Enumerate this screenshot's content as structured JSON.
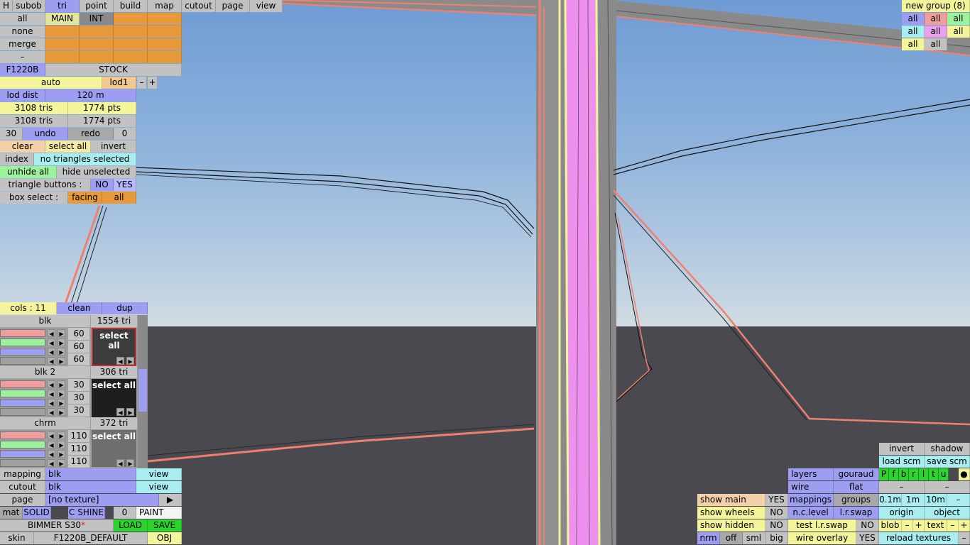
{
  "menu": {
    "h": "H",
    "tabs": [
      "subob",
      "tri",
      "point",
      "build",
      "map",
      "cutout",
      "page",
      "view"
    ],
    "active_tab": "tri"
  },
  "sel_grid": {
    "all": "all",
    "main": "MAIN",
    "int": "INT",
    "none": "none",
    "merge": "merge",
    "dash": "–"
  },
  "model": {
    "name": "F1220B",
    "config": "STOCK"
  },
  "lod": {
    "auto": "auto",
    "lod": "lod1",
    "minus": "–",
    "plus": "+",
    "dist_label": "lod dist",
    "dist_value": "120 m"
  },
  "stats": {
    "tris1": "3108 tris",
    "pts1": "1774 pts",
    "tris2": "3108 tris",
    "pts2": "1774 pts"
  },
  "undo": {
    "count": "30",
    "undo": "undo",
    "redo": "redo",
    "redo_count": "0"
  },
  "sel": {
    "clear": "clear",
    "select_all": "select all",
    "invert": "invert",
    "index": "index",
    "status": "no triangles selected",
    "unhide_all": "unhide all",
    "hide_unselected": "hide unselected"
  },
  "tri_buttons": {
    "label": "triangle buttons :",
    "no": "NO",
    "yes": "YES"
  },
  "box_select": {
    "label": "box select :",
    "facing": "facing",
    "all": "all"
  },
  "cols": {
    "label": "cols : 11",
    "clean": "clean",
    "dup": "dup"
  },
  "materials": [
    {
      "name": "blk",
      "tris": "1554 tri",
      "r": "60",
      "g": "60",
      "b": "60",
      "btn": "select all"
    },
    {
      "name": "blk 2",
      "tris": "306 tri",
      "r": "30",
      "g": "30",
      "b": "30",
      "btn": "select all"
    },
    {
      "name": "chrm",
      "tris": "372 tri",
      "r": "110",
      "g": "110",
      "b": "110",
      "btn": "select all"
    }
  ],
  "bottom_left": {
    "mapping": "mapping",
    "mapping_val": "blk",
    "view": "view",
    "cutout": "cutout",
    "cutout_val": "blk",
    "page": "page",
    "page_val": "[no texture]",
    "play": "▶",
    "mat": "mat",
    "solid": "SOLID",
    "cshine": "C SHINE",
    "zero": "0",
    "paint": "PAINT",
    "car": "BIMMER S30",
    "star": "*",
    "load": "LOAD",
    "save": "SAVE",
    "skin": "skin",
    "skin_val": "F1220B_DEFAULT",
    "obj": "OBJ"
  },
  "groups": {
    "title": "new group (8)",
    "all": "all"
  },
  "bottom_right": {
    "invert": "invert",
    "shadow": "shadow",
    "load_scm": "load scm",
    "save_scm": "save scm",
    "letters": [
      "P",
      "f",
      "b",
      "r",
      "l",
      "t",
      "u"
    ],
    "dot": "●",
    "dash": "–",
    "layers": "layers",
    "gouraud": "gouraud",
    "wire": "wire",
    "flat": "flat",
    "mappings": "mappings",
    "groups": "groups",
    "d1": "0.1m",
    "d2": "1m",
    "d3": "10m",
    "nclevel": "n.c.level",
    "lrswap": "l.r.swap",
    "origin": "origin",
    "object": "object",
    "test_lrswap": "test l.r.swap",
    "no": "NO",
    "yes": "YES",
    "blob": "blob",
    "text": "text",
    "minus": "–",
    "plus": "+",
    "wire_overlay": "wire overlay",
    "reload": "reload textures",
    "show_main": "show main",
    "show_wheels": "show wheels",
    "show_hidden": "show hidden",
    "nrm": "nrm",
    "off": "off",
    "sml": "sml",
    "big": "big"
  }
}
